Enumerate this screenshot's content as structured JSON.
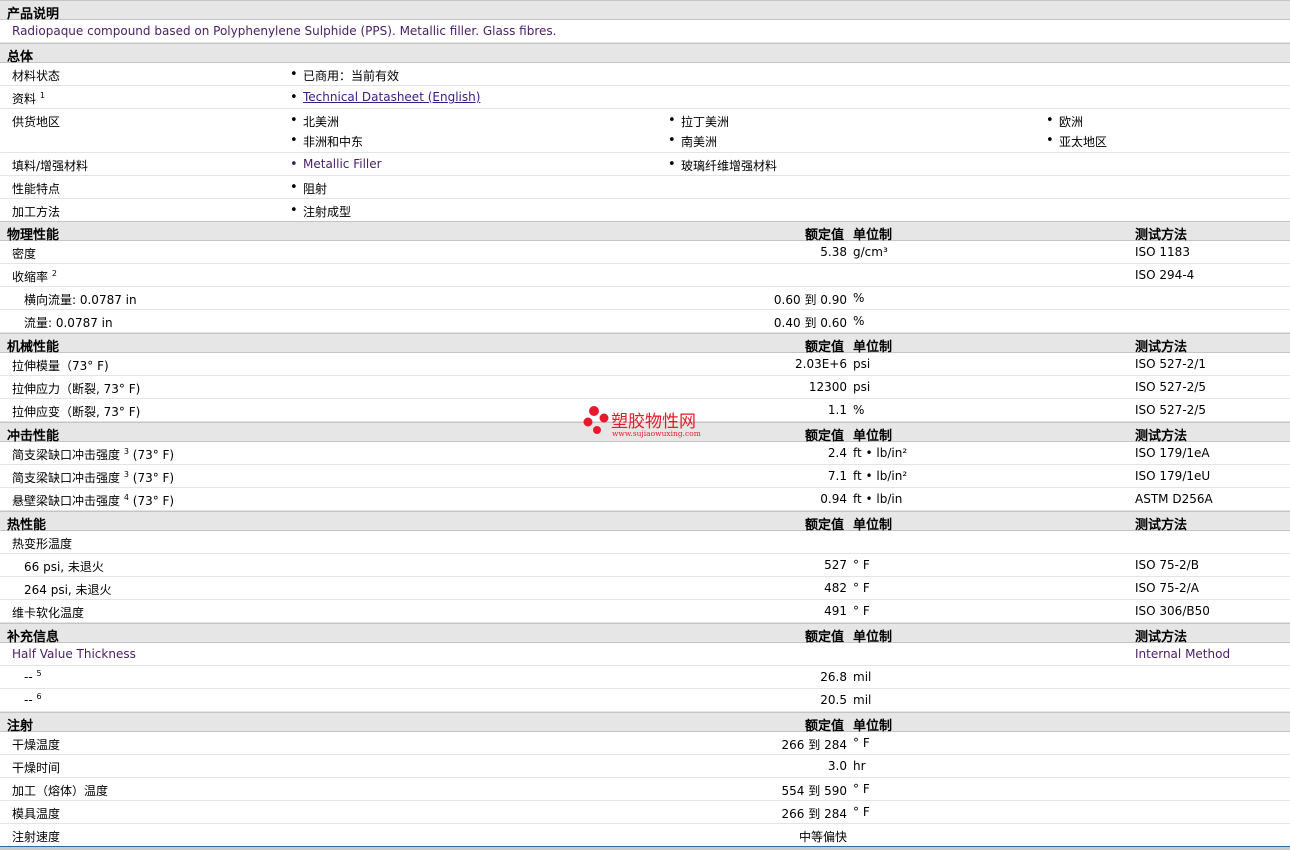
{
  "description": {
    "header": "产品说明",
    "text": "Radiopaque compound based on Polyphenylene Sulphide (PPS). Metallic filler. Glass fibres."
  },
  "general": {
    "header": "总体",
    "status_label": "材料状态",
    "status_value": "已商用：当前有效",
    "docs_label": "资料",
    "docs_sup": "1",
    "docs_link": "Technical Datasheet (English)",
    "regions_label": "供货地区",
    "regions": [
      "北美洲",
      "拉丁美洲",
      "欧洲",
      "非洲和中东",
      "南美洲",
      "亚太地区"
    ],
    "filler_label": "填料/增强材料",
    "fillers": [
      "Metallic Filler",
      "玻璃纤维增强材料"
    ],
    "features_label": "性能特点",
    "feature": "阻射",
    "processing_label": "加工方法",
    "processing": "注射成型"
  },
  "columns": {
    "nominal": "额定值",
    "unit": "单位制",
    "test": "测试方法"
  },
  "physical": {
    "header": "物理性能",
    "density_label": "密度",
    "density_value": "5.38",
    "density_unit": "g/cm³",
    "density_test": "ISO 1183",
    "shrink_label": "收缩率",
    "shrink_sup": "2",
    "shrink_test": "ISO 294-4",
    "shrink_rows": [
      {
        "label": "横向流量: 0.0787 in",
        "low": "0.60",
        "to": "到",
        "high": "0.90",
        "unit": "%"
      },
      {
        "label": "流量: 0.0787 in",
        "low": "0.40",
        "to": "到",
        "high": "0.60",
        "unit": "%"
      }
    ]
  },
  "mechanical": {
    "header": "机械性能",
    "rows": [
      {
        "label": "拉伸模量（73° F)",
        "value": "2.03E+6",
        "unit": "psi",
        "test": "ISO 527-2/1"
      },
      {
        "label": "拉伸应力（断裂, 73° F)",
        "value": "12300",
        "unit": "psi",
        "test": "ISO 527-2/5"
      },
      {
        "label": "拉伸应变（断裂, 73° F)",
        "value": "1.1",
        "unit": "%",
        "test": "ISO 527-2/5"
      }
    ]
  },
  "impact": {
    "header": "冲击性能",
    "rows": [
      {
        "label": "简支梁缺口冲击强度",
        "sup": "3",
        "cond": "(73° F)",
        "value": "2.4",
        "unit": "ft • lb/in²",
        "test": "ISO 179/1eA"
      },
      {
        "label": "简支梁缺口冲击强度",
        "sup": "3",
        "cond": "(73° F)",
        "value": "7.1",
        "unit": "ft • lb/in²",
        "test": "ISO 179/1eU"
      },
      {
        "label": "悬壁梁缺口冲击强度",
        "sup": "4",
        "cond": "(73° F)",
        "value": "0.94",
        "unit": "ft • lb/in",
        "test": "ASTM D256A"
      }
    ]
  },
  "thermal": {
    "header": "热性能",
    "hdt_label": "热变形温度",
    "rows": [
      {
        "label": "66 psi, 未退火",
        "value": "527",
        "unit": "° F",
        "test": "ISO 75-2/B"
      },
      {
        "label": "264 psi, 未退火",
        "value": "482",
        "unit": "° F",
        "test": "ISO 75-2/A"
      }
    ],
    "vicat_label": "维卡软化温度",
    "vicat_value": "491",
    "vicat_unit": "° F",
    "vicat_test": "ISO 306/B50"
  },
  "supplemental": {
    "header": "补充信息",
    "hvt_label": "Half Value Thickness",
    "hvt_test": "Internal Method",
    "rows": [
      {
        "label": "--",
        "sup": "5",
        "value": "26.8",
        "unit": "mil"
      },
      {
        "label": "--",
        "sup": "6",
        "value": "20.5",
        "unit": "mil"
      }
    ]
  },
  "injection": {
    "header": "注射",
    "dry_temp_label": "干燥温度",
    "dry_temp_low": "266",
    "dry_temp_to": "到",
    "dry_temp_high": "284",
    "dry_temp_unit": "° F",
    "dry_time_label": "干燥时间",
    "dry_time_value": "3.0",
    "dry_time_unit": "hr",
    "melt_label": "加工（熔体）温度",
    "melt_low": "554",
    "melt_to": "到",
    "melt_high": "590",
    "melt_unit": "° F",
    "mold_label": "模具温度",
    "mold_low": "266",
    "mold_to": "到",
    "mold_high": "284",
    "mold_unit": "° F",
    "speed_label": "注射速度",
    "speed_value": "中等偏快"
  },
  "watermark": {
    "name": "塑胶物性网",
    "url": "www.sujiaowuxing.com",
    "color": "#e8192c"
  }
}
